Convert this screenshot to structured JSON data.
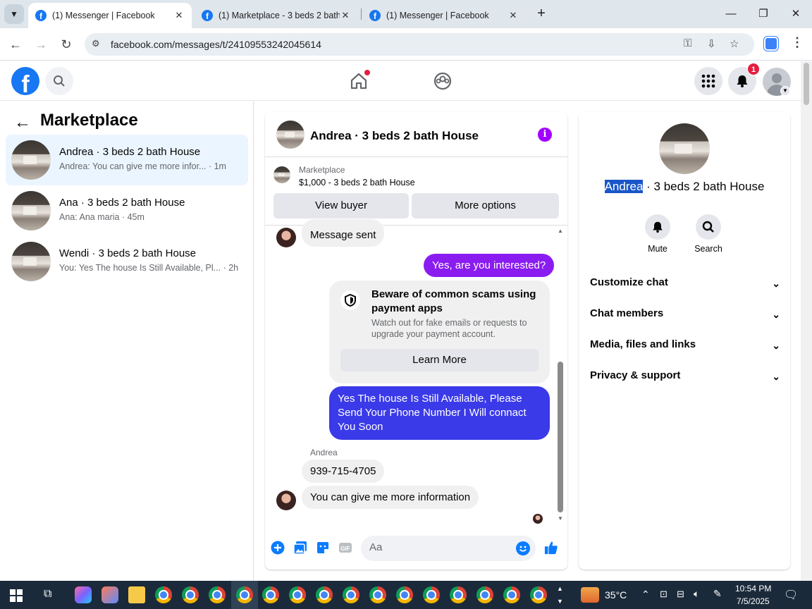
{
  "browser": {
    "tabs": [
      {
        "title": "(1) Messenger | Facebook",
        "active": true
      },
      {
        "title": "(1) Marketplace - 3 beds 2 bath",
        "active": false
      },
      {
        "title": "(1) Messenger | Facebook",
        "active": false
      }
    ],
    "url": "facebook.com/messages/t/24109553242045614"
  },
  "fb_header": {
    "notification_count": "1"
  },
  "marketplace": {
    "title": "Marketplace",
    "conversations": [
      {
        "name": "Andrea · 3 beds 2 bath House",
        "preview": "Andrea: You can give me more infor... · 1m"
      },
      {
        "name": "Ana · 3 beds 2 bath House",
        "preview": "Ana: Ana maria · 45m"
      },
      {
        "name": "Wendi · 3 beds 2 bath House",
        "preview": "You: Yes The house Is Still Available, Pl... · 2h"
      }
    ]
  },
  "chat": {
    "title": "Andrea · 3 beds 2 bath House",
    "listing": {
      "label": "Marketplace",
      "summary": "$1,000 - 3 beds 2 bath House",
      "view_buyer": "View buyer",
      "more_options": "More options"
    },
    "messages": {
      "m1": "Message sent",
      "m2": "Yes, are you interested?",
      "scam_title": "Beware of common scams using payment apps",
      "scam_body": "Watch out for fake emails or requests to upgrade your payment account.",
      "learn_more": "Learn More",
      "m3": "Yes The house Is Still Available, Please Send Your Phone Number I Will connact You Soon",
      "sender": "Andrea",
      "m4": "939-715-4705",
      "m5": "You can give me more information"
    },
    "composer_placeholder": "Aa"
  },
  "right_panel": {
    "name_highlight": "Andrea",
    "name_rest": " · 3 beds 2 bath House",
    "actions": {
      "mute": "Mute",
      "search": "Search"
    },
    "sections": [
      "Customize chat",
      "Chat members",
      "Media, files and links",
      "Privacy & support"
    ]
  },
  "taskbar": {
    "temperature": "35°C",
    "time": "10:54 PM",
    "date": "7/5/2025"
  },
  "colors": {
    "fb_blue": "#1877f2",
    "messenger_purple": "#a100ff",
    "bubble_purple": "#8a1cf0",
    "bubble_blue": "#3a3ae8"
  }
}
